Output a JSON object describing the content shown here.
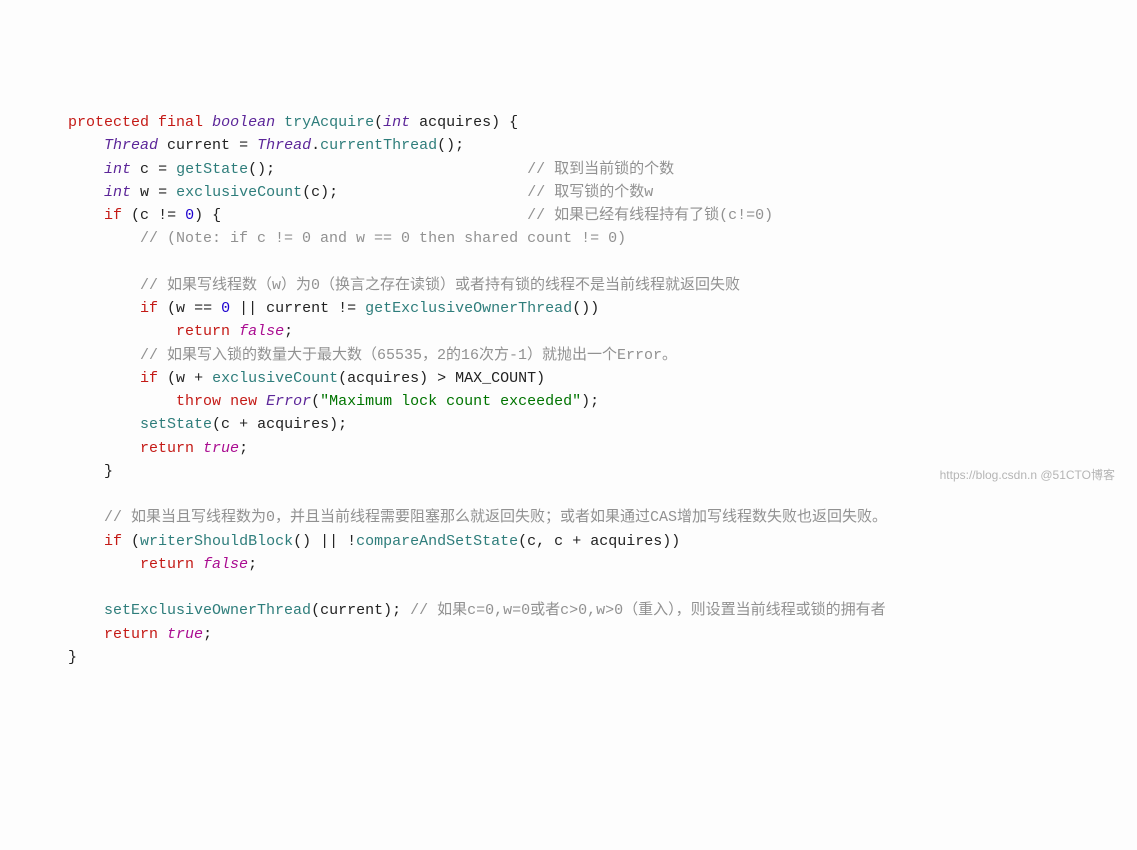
{
  "code": {
    "l1": {
      "protected": "protected",
      "final": "final",
      "boolean": "boolean",
      "method": "tryAcquire",
      "int": "int",
      "param": "acquires"
    },
    "l2": {
      "type": "Thread",
      "var": "current",
      "cls": "Thread",
      "call": "currentThread"
    },
    "l3": {
      "type": "int",
      "var": "c",
      "call": "getState",
      "comment": "// 取到当前锁的个数"
    },
    "l4": {
      "type": "int",
      "var": "w",
      "call": "exclusiveCount",
      "arg": "c",
      "comment": "// 取写锁的个数w"
    },
    "l5": {
      "if": "if",
      "var": "c",
      "num": "0",
      "comment": "// 如果已经有线程持有了锁(c!=0)"
    },
    "l6": {
      "comment": "// (Note: if c != 0 and w == 0 then shared count != 0)"
    },
    "l7": {
      "comment": "// 如果写线程数（w）为0（换言之存在读锁）或者持有锁的线程不是当前线程就返回失败"
    },
    "l8": {
      "if": "if",
      "w": "w",
      "num": "0",
      "cur": "current",
      "call": "getExclusiveOwnerThread"
    },
    "l9": {
      "return": "return",
      "val": "false"
    },
    "l10": {
      "comment": "// 如果写入锁的数量大于最大数（65535，2的16次方-1）就抛出一个Error。"
    },
    "l11": {
      "if": "if",
      "w": "w",
      "call": "exclusiveCount",
      "arg": "acquires",
      "max": "MAX_COUNT"
    },
    "l12": {
      "throw": "throw",
      "new": "new",
      "type": "Error",
      "str": "\"Maximum lock count exceeded\""
    },
    "l13": {
      "call": "setState",
      "c": "c",
      "arg": "acquires"
    },
    "l14": {
      "return": "return",
      "val": "true"
    },
    "l15": {
      "comment": "// 如果当且写线程数为0，并且当前线程需要阻塞那么就返回失败；或者如果通过CAS增加写线程数失败也返回失败。"
    },
    "l16": {
      "if": "if",
      "call1": "writerShouldBlock",
      "call2": "compareAndSetState",
      "c1": "c",
      "c2": "c",
      "arg": "acquires"
    },
    "l17": {
      "return": "return",
      "val": "false"
    },
    "l18": {
      "call": "setExclusiveOwnerThread",
      "arg": "current",
      "comment": "// 如果c=0,w=0或者c>0,w>0（重入），则设置当前线程或锁的拥有者"
    },
    "l19": {
      "return": "return",
      "val": "true"
    }
  },
  "watermark": "https://blog.csdn.n @51CTO博客"
}
